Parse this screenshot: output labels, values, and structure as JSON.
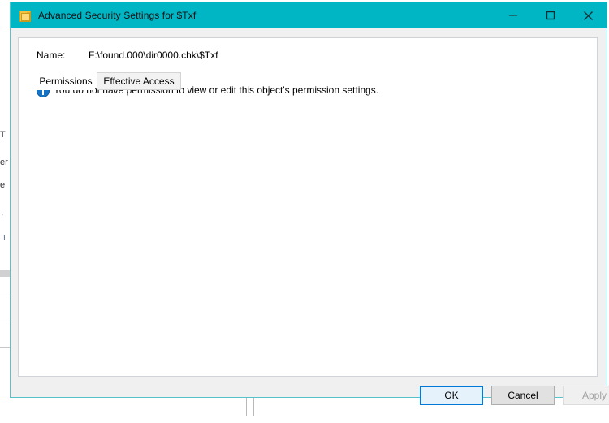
{
  "window": {
    "title": "Advanced Security Settings for $Txf",
    "icon": "folder-security-icon",
    "accent_color": "#00b6c4",
    "border_color": "#56c3cb",
    "controls": {
      "minimize": "Minimize",
      "maximize": "Maximize",
      "close": "Close"
    }
  },
  "name_row": {
    "label": "Name:",
    "value": "F:\\found.000\\dir0000.chk\\$Txf"
  },
  "tabs": [
    {
      "label": "Permissions",
      "active": true
    },
    {
      "label": "Effective Access",
      "active": false
    }
  ],
  "info": {
    "icon": "info-icon",
    "icon_color": "#1574c8",
    "message": "You do not have permission to view or edit this object's permission settings."
  },
  "buttons": {
    "ok": "OK",
    "cancel": "Cancel",
    "apply": "Apply",
    "ok_focused": true,
    "apply_disabled": true
  },
  "background": {
    "fragments": [
      "T",
      "er",
      "e",
      "'",
      "I"
    ]
  }
}
